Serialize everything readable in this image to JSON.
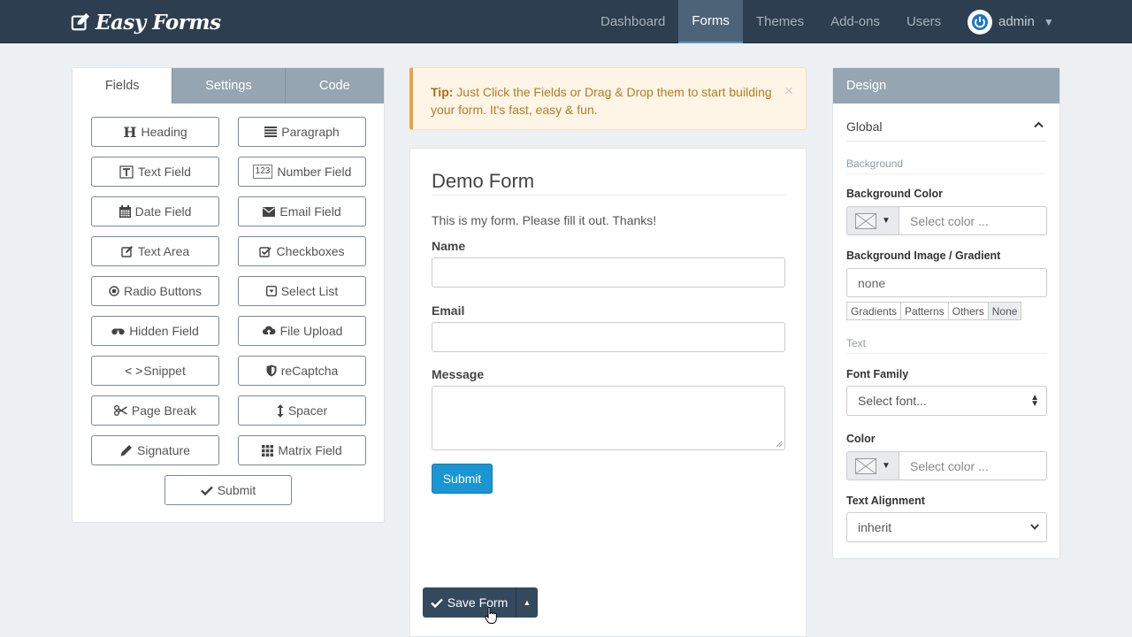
{
  "brand": {
    "name": "Easy Forms"
  },
  "nav": {
    "items": [
      "Dashboard",
      "Forms",
      "Themes",
      "Add-ons",
      "Users"
    ],
    "active": "Forms",
    "user": "admin"
  },
  "left_panel": {
    "tabs": [
      "Fields",
      "Settings",
      "Code"
    ],
    "active_tab": "Fields",
    "fields": [
      {
        "label": "Heading",
        "icon": "heading-icon"
      },
      {
        "label": "Paragraph",
        "icon": "paragraph-icon"
      },
      {
        "label": "Text Field",
        "icon": "text-field-icon"
      },
      {
        "label": "Number Field",
        "icon": "number-icon"
      },
      {
        "label": "Date Field",
        "icon": "calendar-icon"
      },
      {
        "label": "Email Field",
        "icon": "envelope-icon"
      },
      {
        "label": "Text Area",
        "icon": "edit-icon"
      },
      {
        "label": "Checkboxes",
        "icon": "checkbox-icon"
      },
      {
        "label": "Radio Buttons",
        "icon": "radio-icon"
      },
      {
        "label": "Select List",
        "icon": "select-icon"
      },
      {
        "label": "Hidden Field",
        "icon": "eye-slash-icon"
      },
      {
        "label": "File Upload",
        "icon": "upload-icon"
      },
      {
        "label": "Snippet",
        "icon": "code-icon",
        "prefix": "< >"
      },
      {
        "label": "reCaptcha",
        "icon": "shield-icon"
      },
      {
        "label": "Page Break",
        "icon": "scissors-icon"
      },
      {
        "label": "Spacer",
        "icon": "arrows-vertical-icon"
      },
      {
        "label": "Signature",
        "icon": "pencil-icon"
      },
      {
        "label": "Matrix Field",
        "icon": "grid-icon"
      },
      {
        "label": "Submit",
        "icon": "check-icon"
      }
    ]
  },
  "tip": {
    "bold": "Tip:",
    "text": " Just Click the Fields or Drag & Drop them to start building your form. It's fast, easy & fun.",
    "close": "×"
  },
  "form": {
    "title": "Demo Form",
    "description": "This is my form. Please fill it out. Thanks!",
    "fields": [
      {
        "label": "Name",
        "value": ""
      },
      {
        "label": "Email",
        "value": ""
      },
      {
        "label": "Message",
        "value": ""
      }
    ],
    "submit": "Submit",
    "save": "Save Form"
  },
  "design": {
    "title": "Design",
    "global": "Global",
    "section_background": "Background",
    "bg_color_label": "Background Color",
    "bg_color_placeholder": "Select color ...",
    "bg_image_label": "Background Image / Gradient",
    "bg_image_value": "none",
    "bg_image_buttons": [
      "Gradients",
      "Patterns",
      "Others",
      "None"
    ],
    "section_text": "Text",
    "font_family_label": "Font Family",
    "font_family_value": "Select font...",
    "color_label": "Color",
    "color_placeholder": "Select color ...",
    "alignment_label": "Text Alignment",
    "alignment_value": "inherit"
  },
  "colors": {
    "navbar": "#2c3e50",
    "active_nav": "#4d6478",
    "tab_inactive": "#95a5b2",
    "submit": "#1a96d4",
    "save": "#34495e",
    "tip_border": "#e5a444"
  }
}
